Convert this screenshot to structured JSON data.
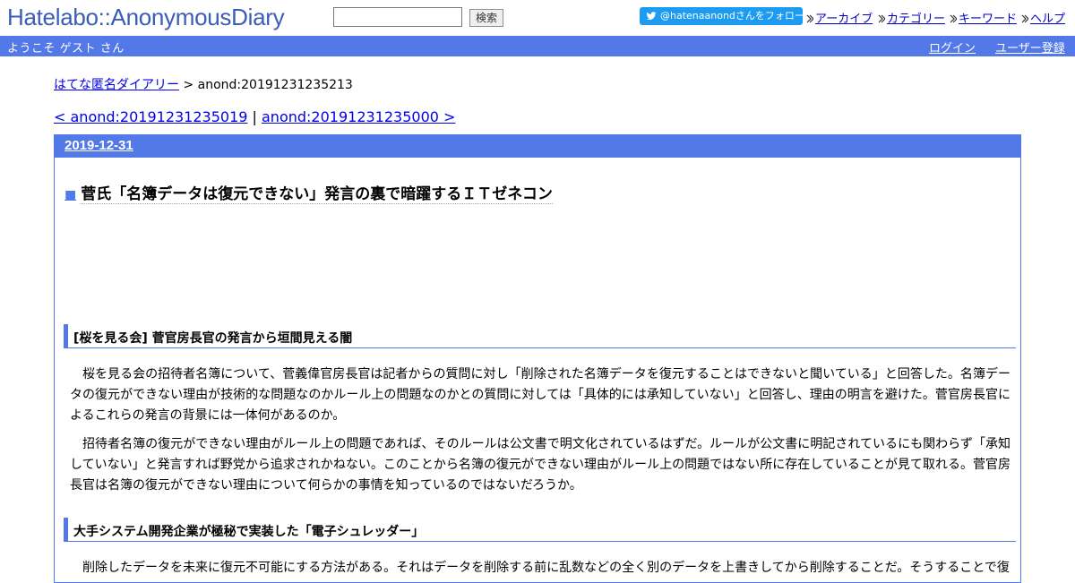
{
  "header": {
    "logo": "Hatelabo::AnonymousDiary",
    "search_placeholder": "",
    "search_button": "検索",
    "follow_label": "@hatenaanondさんをフォロー",
    "links": [
      "アーカイブ",
      "カテゴリー",
      "キーワード",
      "ヘルプ"
    ]
  },
  "userbar": {
    "welcome": "ようこそ ゲスト さん",
    "login": "ログイン",
    "register": "ユーザー登録"
  },
  "breadcrumb": {
    "root": "はてな匿名ダイアリー",
    "sep": " > ",
    "current": "anond:20191231235213"
  },
  "pager": {
    "prev": "< anond:20191231235019",
    "sep": " | ",
    "next": "anond:20191231235000 >"
  },
  "entry": {
    "date": "2019-12-31",
    "bullet": "■",
    "title": "菅氏「名簿データは復元できない」発言の裏で暗躍するＩＴゼネコン",
    "sections": [
      {
        "heading": "[桜を見る会] 菅官房長官の発言から垣間見える闇",
        "paragraphs": [
          "桜を見る会の招待者名簿について、菅義偉官房長官は記者からの質問に対し「削除された名簿データを復元することはできないと聞いている」と回答した。名簿データの復元ができない理由が技術的な問題なのかルール上の問題なのかとの質問に対しては「具体的には承知していない」と回答し、理由の明言を避けた。菅官房長官によるこれらの発言の背景には一体何があるのか。",
          "招待者名簿の復元ができない理由がルール上の問題であれば、そのルールは公文書で明文化されているはずだ。ルールが公文書に明記されているにも関わらず「承知していない」と発言すれば野党から追求されかねない。このことから名簿の復元ができない理由がルール上の問題ではない所に存在していることが見て取れる。菅官房長官は名簿の復元ができない理由について何らかの事情を知っているのではないだろうか。"
        ]
      },
      {
        "heading": "大手システム開発企業が極秘で実装した「電子シュレッダー」",
        "paragraphs": [
          "削除したデータを未来に復元不可能にする方法がある。それはデータを削除する前に乱数などの全く別のデータを上書きしてから削除することだ。そうすることで復"
        ]
      }
    ]
  },
  "colors": {
    "accent": "#5279e7",
    "logo": "#3b5cb7",
    "twitter": "#1d9bf0"
  }
}
